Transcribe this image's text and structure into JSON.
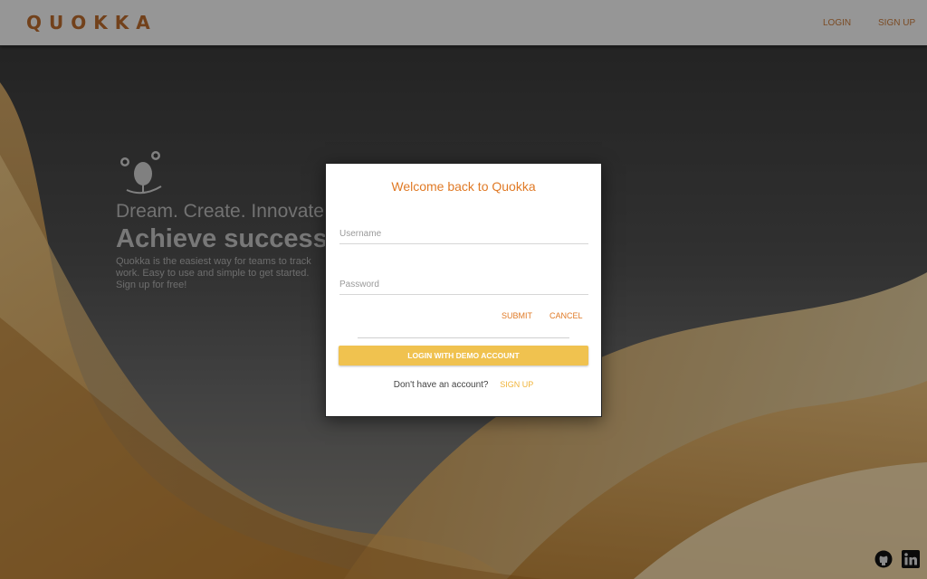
{
  "header": {
    "logo_text": "QUOKKA",
    "nav": {
      "login": "LOGIN",
      "signup": "SIGN UP"
    }
  },
  "hero": {
    "line1": "Dream. Create. Innovate.",
    "line2": "Achieve success with Quokka",
    "line3": "Quokka is the easiest way for teams to track work. Easy to use and simple to get started. Sign up for free!"
  },
  "modal": {
    "title": "Welcome back to Quokka",
    "username": {
      "placeholder": "Username",
      "value": ""
    },
    "password": {
      "placeholder": "Password",
      "value": ""
    },
    "submit_label": "SUBMIT",
    "cancel_label": "CANCEL",
    "demo_label": "LOGIN WITH DEMO ACCOUNT",
    "prompt_text": "Don't have an account?",
    "signup_label": "SIGN UP"
  },
  "footer": {
    "icons": [
      "github-icon",
      "linkedin-icon"
    ]
  },
  "colors": {
    "accent": "#e07a26",
    "logo": "#b96a2c",
    "demo_button": "#f0c24f"
  }
}
